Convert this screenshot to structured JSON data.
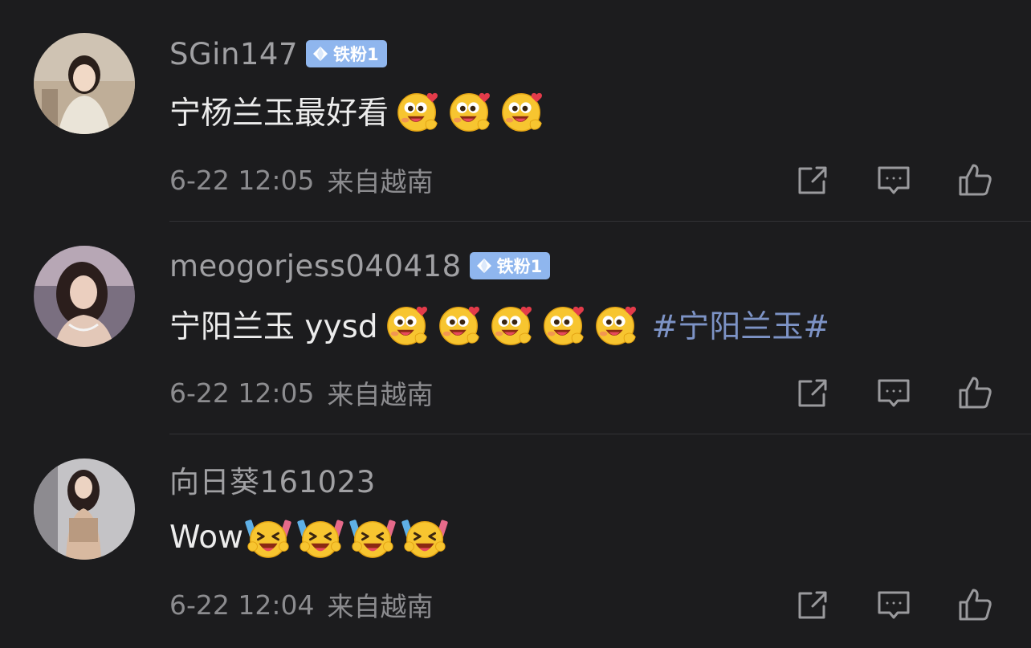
{
  "comments": [
    {
      "username": "SGin147",
      "badge": {
        "label": "铁粉1",
        "color": "#8fb6ee"
      },
      "text": "宁杨兰玉最好看",
      "emojis": [
        "heart-eyes-emoji",
        "heart-eyes-emoji",
        "heart-eyes-emoji"
      ],
      "hashtag": "",
      "time": "6-22 12:05",
      "location": "来自越南"
    },
    {
      "username": "meogorjess040418",
      "badge": {
        "label": "铁粉1",
        "color": "#8fb6ee"
      },
      "text": "宁阳兰玉 yysd",
      "emojis": [
        "heart-eyes-emoji",
        "heart-eyes-emoji",
        "heart-eyes-emoji",
        "heart-eyes-emoji",
        "heart-eyes-emoji"
      ],
      "hashtag": "#宁阳兰玉#",
      "time": "6-22 12:05",
      "location": "来自越南"
    },
    {
      "username": "向日葵161023",
      "badge": null,
      "text": "Wow",
      "emojis": [
        "cheering-emoji",
        "cheering-emoji",
        "cheering-emoji",
        "cheering-emoji"
      ],
      "hashtag": "",
      "time": "6-22 12:04",
      "location": "来自越南"
    }
  ],
  "actions": [
    "share-icon",
    "comment-icon",
    "like-icon"
  ],
  "colors": {
    "background": "#1c1c1e",
    "hashtag": "#7d93c6",
    "badge": "#8fb6ee"
  }
}
